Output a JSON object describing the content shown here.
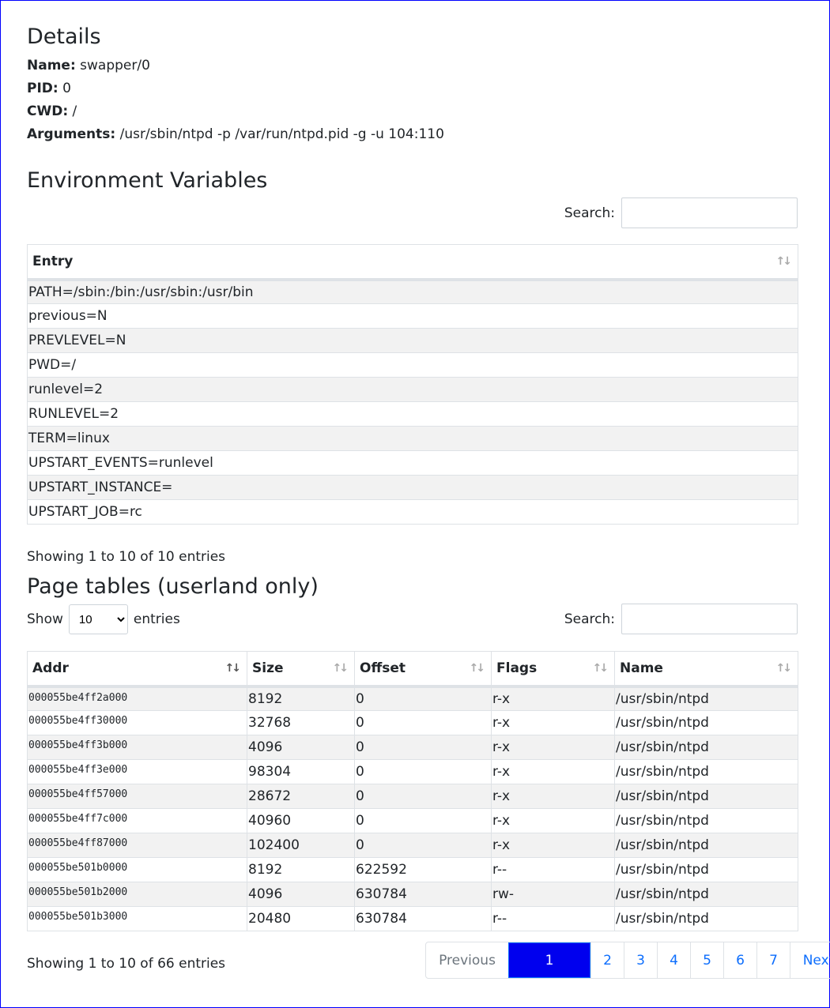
{
  "details": {
    "title": "Details",
    "name_label": "Name:",
    "name": "swapper/0",
    "pid_label": "PID:",
    "pid": "0",
    "cwd_label": "CWD:",
    "cwd": "/",
    "args_label": "Arguments:",
    "args": "/usr/sbin/ntpd -p /var/run/ntpd.pid -g -u 104:110"
  },
  "env": {
    "title": "Environment Variables",
    "search_label": "Search:",
    "search_value": "",
    "column": "Entry",
    "rows": [
      "PATH=/sbin:/bin:/usr/sbin:/usr/bin",
      "previous=N",
      "PREVLEVEL=N",
      "PWD=/",
      "runlevel=2",
      "RUNLEVEL=2",
      "TERM=linux",
      "UPSTART_EVENTS=runlevel",
      "UPSTART_INSTANCE=",
      "UPSTART_JOB=rc"
    ],
    "info": "Showing 1 to 10 of 10 entries"
  },
  "pages": {
    "title": "Page tables (userland only)",
    "show_label": "Show",
    "show_value": "10",
    "entries_label": "entries",
    "search_label": "Search:",
    "search_value": "",
    "columns": [
      "Addr",
      "Size",
      "Offset",
      "Flags",
      "Name"
    ],
    "rows": [
      [
        "000055be4ff2a000",
        "8192",
        "0",
        "r-x",
        "/usr/sbin/ntpd"
      ],
      [
        "000055be4ff30000",
        "32768",
        "0",
        "r-x",
        "/usr/sbin/ntpd"
      ],
      [
        "000055be4ff3b000",
        "4096",
        "0",
        "r-x",
        "/usr/sbin/ntpd"
      ],
      [
        "000055be4ff3e000",
        "98304",
        "0",
        "r-x",
        "/usr/sbin/ntpd"
      ],
      [
        "000055be4ff57000",
        "28672",
        "0",
        "r-x",
        "/usr/sbin/ntpd"
      ],
      [
        "000055be4ff7c000",
        "40960",
        "0",
        "r-x",
        "/usr/sbin/ntpd"
      ],
      [
        "000055be4ff87000",
        "102400",
        "0",
        "r-x",
        "/usr/sbin/ntpd"
      ],
      [
        "000055be501b0000",
        "8192",
        "622592",
        "r--",
        "/usr/sbin/ntpd"
      ],
      [
        "000055be501b2000",
        "4096",
        "630784",
        "rw-",
        "/usr/sbin/ntpd"
      ],
      [
        "000055be501b3000",
        "20480",
        "630784",
        "r--",
        "/usr/sbin/ntpd"
      ]
    ],
    "info": "Showing 1 to 10 of 66 entries",
    "pagination": {
      "previous": "Previous",
      "pages": [
        "1",
        "2",
        "3",
        "4",
        "5",
        "6",
        "7"
      ],
      "current": "1",
      "next": "Next"
    }
  },
  "colors": {
    "active_page": "#0000ee",
    "link": "#0d6efd",
    "stripe": "#f2f2f2"
  }
}
